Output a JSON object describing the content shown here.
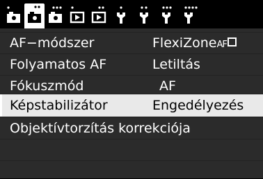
{
  "tabs": [
    {
      "icon": "camera-shooting-icon",
      "dots": 1
    },
    {
      "icon": "camera-shooting-icon",
      "dots": 2
    },
    {
      "icon": "camera-shooting-icon",
      "dots": 3
    },
    {
      "icon": "playback-icon",
      "dots": 1
    },
    {
      "icon": "playback-icon",
      "dots": 2
    },
    {
      "icon": "wrench-setup-icon",
      "dots": 1
    },
    {
      "icon": "wrench-setup-icon",
      "dots": 2
    },
    {
      "icon": "wrench-setup-icon",
      "dots": 3
    },
    {
      "icon": "wrench-setup-icon",
      "dots": 4
    }
  ],
  "active_tab": 1,
  "menu": {
    "items": [
      {
        "label": "AF−módszer",
        "value": "FlexiZone",
        "value_suffix": "AF"
      },
      {
        "label": "Folyamatos AF",
        "value": "Letiltás"
      },
      {
        "label": "Fókuszmód",
        "value": "AF"
      },
      {
        "label": "Képstabilizátor",
        "value": "Engedélyezés"
      },
      {
        "label": "Objektívtorzítás korrekciója",
        "value": ""
      }
    ],
    "selected_index": 3
  },
  "colors": {
    "background": "#000000",
    "panel": "#2b2b2b",
    "highlight": "#e9e9e9",
    "text": "#ffffff",
    "text_selected": "#000000"
  }
}
